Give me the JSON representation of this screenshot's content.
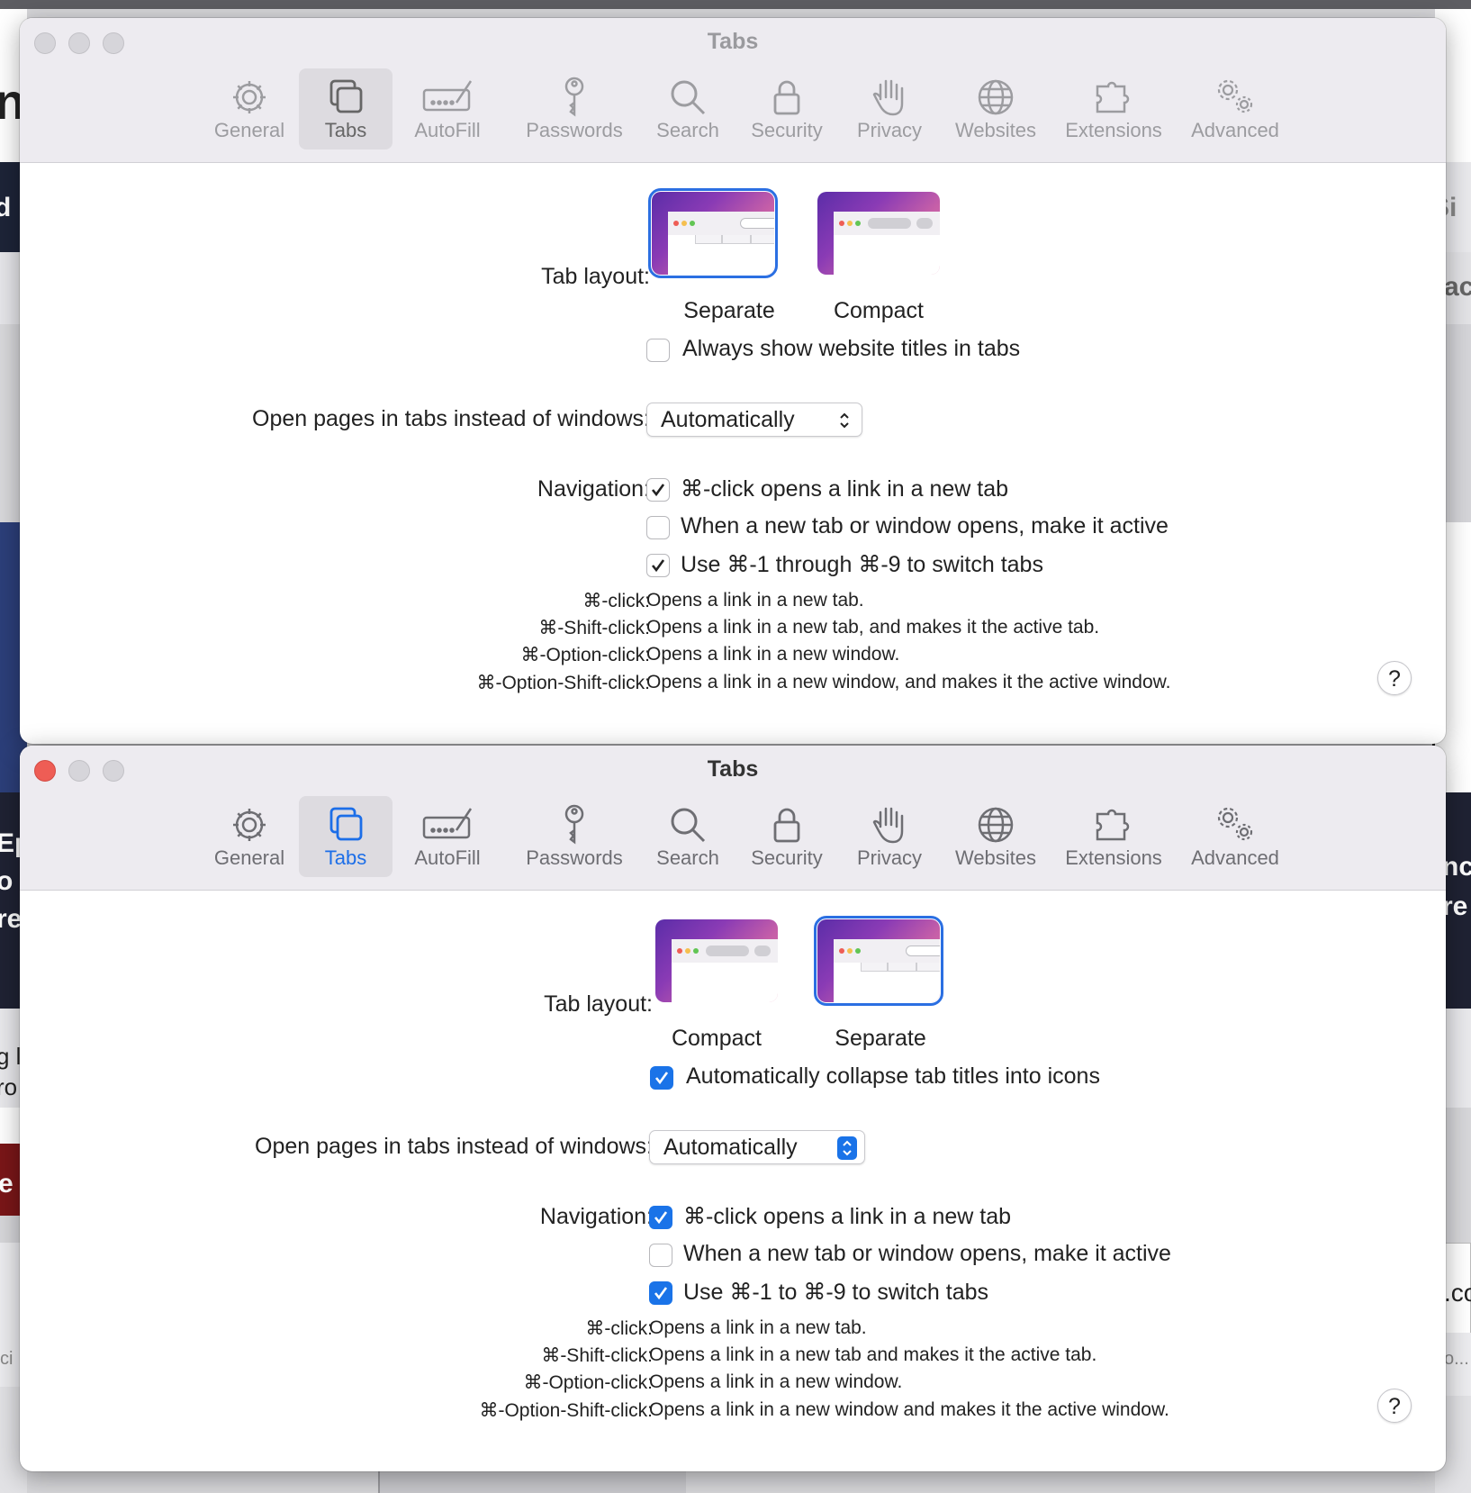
{
  "background": {
    "fragments": [
      "n",
      "d",
      "Si",
      "ac",
      "Ep",
      "o",
      "re",
      "nc",
      "re",
      "g l",
      "ro",
      "e",
      ".co",
      "ci",
      "o..."
    ]
  },
  "windows": [
    {
      "title": "Tabs",
      "toolbar": [
        "General",
        "Tabs",
        "AutoFill",
        "Passwords",
        "Search",
        "Security",
        "Privacy",
        "Websites",
        "Extensions",
        "Advanced"
      ],
      "tab_layout_label": "Tab layout:",
      "layout_options": [
        "Separate",
        "Compact"
      ],
      "selected_layout": "Separate",
      "layout_checkbox": {
        "label": "Always show website titles in tabs",
        "checked": false
      },
      "open_pages_label": "Open pages in tabs instead of windows:",
      "open_pages_value": "Automatically",
      "navigation_label": "Navigation:",
      "navigation": [
        {
          "label": "⌘-click opens a link in a new tab",
          "checked": true
        },
        {
          "label": "When a new tab or window opens, make it active",
          "checked": false
        },
        {
          "label": "Use ⌘-1 through ⌘-9 to switch tabs",
          "checked": true
        }
      ],
      "shortcuts": [
        {
          "key": "⌘-click:",
          "desc": "Opens a link in a new tab."
        },
        {
          "key": "⌘-Shift-click:",
          "desc": "Opens a link in a new tab, and makes it the active tab."
        },
        {
          "key": "⌘-Option-click:",
          "desc": "Opens a link in a new window."
        },
        {
          "key": "⌘-Option-Shift-click:",
          "desc": "Opens a link in a new window, and makes it the active window."
        }
      ],
      "help": "?"
    },
    {
      "title": "Tabs",
      "toolbar": [
        "General",
        "Tabs",
        "AutoFill",
        "Passwords",
        "Search",
        "Security",
        "Privacy",
        "Websites",
        "Extensions",
        "Advanced"
      ],
      "tab_layout_label": "Tab layout:",
      "layout_options": [
        "Compact",
        "Separate"
      ],
      "selected_layout": "Separate",
      "layout_checkbox": {
        "label": "Automatically collapse tab titles into icons",
        "checked": true
      },
      "open_pages_label": "Open pages in tabs instead of windows:",
      "open_pages_value": "Automatically",
      "navigation_label": "Navigation:",
      "navigation": [
        {
          "label": "⌘-click opens a link in a new tab",
          "checked": true
        },
        {
          "label": "When a new tab or window opens, make it active",
          "checked": false
        },
        {
          "label": "Use ⌘-1 to ⌘-9 to switch tabs",
          "checked": true
        }
      ],
      "shortcuts": [
        {
          "key": "⌘-click:",
          "desc": "Opens a link in a new tab."
        },
        {
          "key": "⌘-Shift-click:",
          "desc": "Opens a link in a new tab and makes it the active tab."
        },
        {
          "key": "⌘-Option-click:",
          "desc": "Opens a link in a new window."
        },
        {
          "key": "⌘-Option-Shift-click:",
          "desc": "Opens a link in a new window and makes it the active window."
        }
      ],
      "help": "?"
    }
  ],
  "colors": {
    "accent": "#1a73e8",
    "close_red": "#ee5d55",
    "titlebar": "#edebf0"
  }
}
